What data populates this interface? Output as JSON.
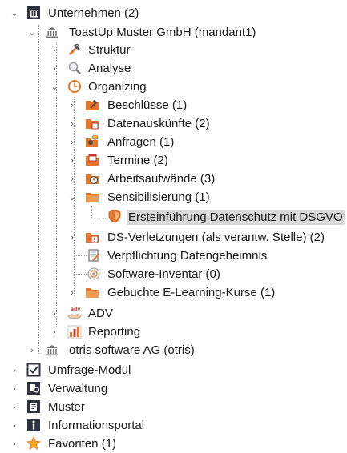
{
  "tree": {
    "items": [
      {
        "label": "Unternehmen (2)",
        "icon": "building-icon",
        "expanded": true
      },
      {
        "label": "ToastUp Muster GmbH (mandant1)",
        "icon": "bank-icon",
        "expanded": true
      },
      {
        "label": "Struktur",
        "icon": "tools-icon",
        "expanded": false
      },
      {
        "label": "Analyse",
        "icon": "magnifier-icon",
        "expanded": false
      },
      {
        "label": "Organizing",
        "icon": "clock-icon",
        "expanded": true
      },
      {
        "label": "Beschlüsse (1)",
        "icon": "gavel-folder-icon",
        "expanded": false
      },
      {
        "label": "Datenauskünfte (2)",
        "icon": "data-folder-icon",
        "expanded": false
      },
      {
        "label": "Anfragen (1)",
        "icon": "request-folder-icon",
        "expanded": false
      },
      {
        "label": "Termine (2)",
        "icon": "calendar-folder-icon",
        "expanded": false
      },
      {
        "label": "Arbeitsaufwände (3)",
        "icon": "clock-folder-icon",
        "expanded": false
      },
      {
        "label": "Sensibilisierung (1)",
        "icon": "folder-icon",
        "expanded": true
      },
      {
        "label": "Ersteinführung Datenschutz mit DSGVO",
        "icon": "shield-icon",
        "selected": true
      },
      {
        "label": "DS-Verletzungen (als verantw. Stelle) (2)",
        "icon": "warning-folder-icon",
        "expanded": false
      },
      {
        "label": "Verpflichtung Datengeheimnis",
        "icon": "pen-document-icon"
      },
      {
        "label": "Software-Inventar (0)",
        "icon": "disc-icon"
      },
      {
        "label": "Gebuchte E-Learning-Kurse (1)",
        "icon": "folder-icon",
        "expanded": false
      },
      {
        "label": "ADV",
        "icon": "adv-handshake-icon",
        "expanded": false
      },
      {
        "label": "Reporting",
        "icon": "bar-chart-icon",
        "expanded": false
      },
      {
        "label": "otris software AG (otris)",
        "icon": "bank-icon",
        "expanded": false
      },
      {
        "label": "Umfrage-Modul",
        "icon": "checkbox-icon",
        "expanded": false
      },
      {
        "label": "Verwaltung",
        "icon": "admin-icon",
        "expanded": false
      },
      {
        "label": "Muster",
        "icon": "template-icon",
        "expanded": false
      },
      {
        "label": "Informationsportal",
        "icon": "info-icon",
        "expanded": false
      },
      {
        "label": "Favoriten (1)",
        "icon": "star-icon",
        "expanded": false
      }
    ]
  },
  "colors": {
    "dark_icon": "#2d3340",
    "orange": "#e8752a",
    "selection": "#d9d9d9",
    "star": "#f5a623"
  }
}
